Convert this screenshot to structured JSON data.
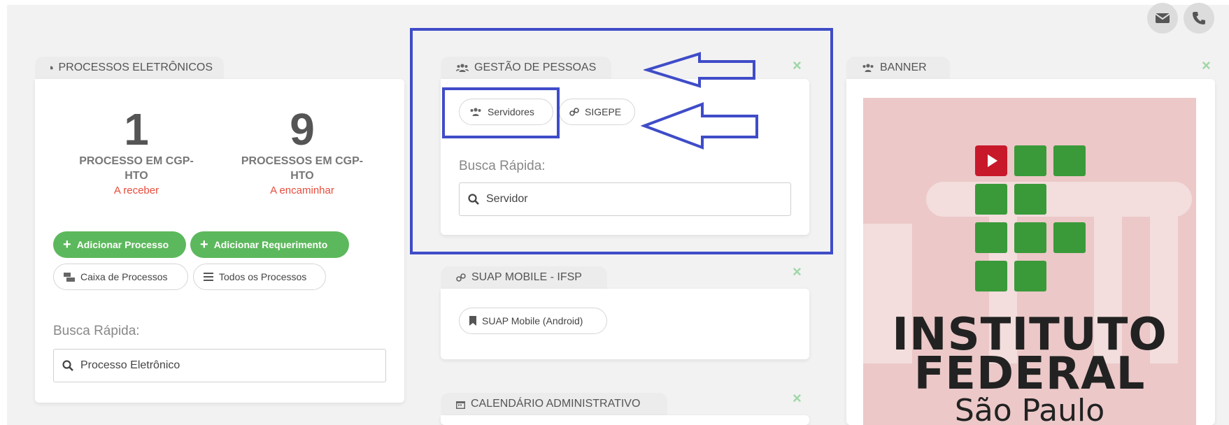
{
  "colors": {
    "accent_green": "#5cb85c",
    "alert_red": "#e74c3c",
    "annotation_blue": "#3f4cc8",
    "ifsp_green": "#3a9a3a",
    "ifsp_red": "#c8192b"
  },
  "header": {
    "icons": [
      "envelope-icon",
      "phone-icon"
    ]
  },
  "processos": {
    "tab_title": "PROCESSOS ELETRÔNICOS",
    "stat1": {
      "number": "1",
      "label_line1": "PROCESSO EM CGP-",
      "label_line2": "HTO",
      "sub": "A receber"
    },
    "stat2": {
      "number": "9",
      "label_line1": "PROCESSOS EM CGP-",
      "label_line2": "HTO",
      "sub": "A encaminhar"
    },
    "btn_add_processo": "Adicionar Processo",
    "btn_add_requerimento": "Adicionar Requerimento",
    "btn_caixa": "Caixa de Processos",
    "btn_todos": "Todos os Processos",
    "busca_label": "Busca Rápida:",
    "search_text": "Processo Eletrônico"
  },
  "gestao": {
    "tab_title": "GESTÃO DE PESSOAS",
    "close": "×",
    "btn_servidores": "Servidores",
    "btn_sigepe": "SIGEPE",
    "busca_label": "Busca Rápida:",
    "search_text": "Servidor"
  },
  "suap": {
    "tab_title": "SUAP MOBILE - IFSP",
    "close": "×",
    "btn_android": "SUAP Mobile (Android)"
  },
  "calendario": {
    "tab_title": "CALENDÁRIO ADMINISTRATIVO",
    "close": "×"
  },
  "banner": {
    "tab_title": "BANNER",
    "close": "×",
    "logo_line1": "INSTITUTO",
    "logo_line2": "FEDERAL",
    "logo_line3": "São Paulo"
  }
}
